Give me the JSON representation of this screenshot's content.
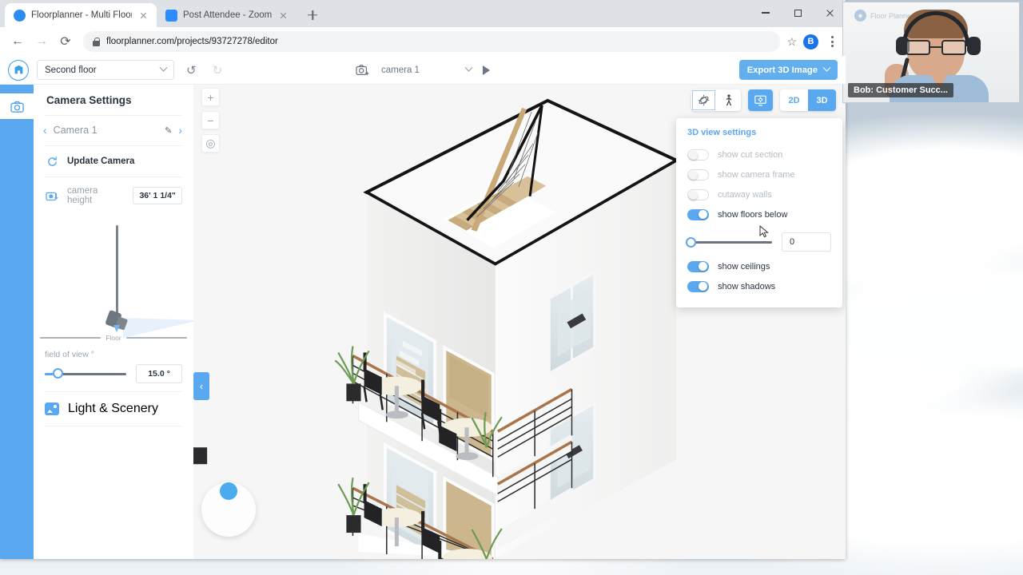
{
  "browser": {
    "tabs": [
      {
        "title": "Floorplanner - Multi Floor & Mu",
        "favicon": "floorplanner-icon",
        "active": true
      },
      {
        "title": "Post Attendee - Zoom",
        "favicon": "zoom-icon",
        "active": false
      }
    ],
    "newtab_label": "+",
    "url": "floorplanner.com/projects/93727278/editor",
    "profile_initial": "B",
    "window_controls": [
      "minimize",
      "maximize",
      "close"
    ]
  },
  "app": {
    "logo": "floorplanner-logo",
    "floor_select": {
      "value": "Second floor"
    },
    "undo_label": "↺",
    "redo_label": "↻",
    "camera_bar": {
      "icon": "add-camera-icon",
      "name": "camera 1",
      "play_label": "▶"
    },
    "export_button": {
      "label": "Export 3D Image"
    }
  },
  "sidebar": {
    "rail_icon": "camera-icon",
    "title": "Camera Settings",
    "camera_nav": {
      "prev": "‹",
      "label": "Camera 1",
      "edit": "✎",
      "next": "›"
    },
    "update_camera": {
      "icon": "refresh-icon",
      "label": "Update Camera"
    },
    "camera_height": {
      "icon": "camera-height-icon",
      "label": "camera height",
      "value": "36' 1 1/4\""
    },
    "viz": {
      "floor_label": "Floor"
    },
    "field_of_view": {
      "label": "field of view °",
      "value": "15.0 °"
    },
    "light_scenery": {
      "icon": "image-icon",
      "label": "Light & Scenery"
    },
    "collapse_icon": "chevron-left-icon"
  },
  "canvas": {
    "zoom_in": "+",
    "zoom_out": "−",
    "recenter": "◎",
    "compass": "orbit-compass"
  },
  "viewmode": {
    "orbit": {
      "icon": "orbit-icon",
      "selected": true
    },
    "walk": {
      "icon": "walk-icon",
      "selected": false
    },
    "settings": {
      "icon": "view-settings-icon",
      "active": true
    },
    "d2": {
      "label": "2D",
      "active": false
    },
    "d3": {
      "label": "3D",
      "active": true
    }
  },
  "view_settings": {
    "title": "3D view settings",
    "toggles": [
      {
        "label": "show cut section",
        "on": false
      },
      {
        "label": "show camera frame",
        "on": false
      },
      {
        "label": "cutaway walls",
        "on": false
      },
      {
        "label": "show floors below",
        "on": true
      }
    ],
    "slider": {
      "value": "0"
    },
    "toggles_after": [
      {
        "label": "show ceilings",
        "on": true
      },
      {
        "label": "show shadows",
        "on": true
      }
    ]
  },
  "webcam": {
    "name_label": "Bob: Customer Succ...",
    "watermark": "Floor Planner"
  },
  "colors": {
    "accent": "#5aa8ef",
    "export_button": "#62aff0",
    "rail": "#5aa8ef",
    "toggle_on": "#5aa8ef"
  }
}
